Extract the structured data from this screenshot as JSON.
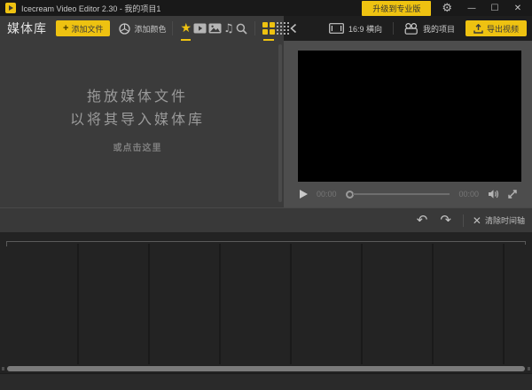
{
  "titlebar": {
    "app_title": "Icecream Video Editor 2.30 - 我的项目1",
    "upgrade_label": "升级到专业版",
    "minimize_glyph": "—",
    "maximize_glyph": "☐",
    "close_glyph": "✕",
    "gear_glyph": "⚙"
  },
  "media_library": {
    "title": "媒体库",
    "add_file_label": "添加文件",
    "add_file_plus": "+",
    "add_color_label": "添加颜色",
    "star_glyph": "★",
    "music_glyph": "♫",
    "dropzone_line1": "拖放媒体文件",
    "dropzone_line2": "以将其导入媒体库",
    "dropzone_line3": "或点击这里"
  },
  "project_bar": {
    "aspect_label": "16:9 横向",
    "projects_label": "我的项目",
    "export_label": "导出视频"
  },
  "preview": {
    "current_time": "00:00",
    "total_time": "00:00"
  },
  "timeline_bar": {
    "undo_glyph": "↶",
    "redo_glyph": "↷",
    "clear_x": "✕",
    "clear_label": "清除时间轴"
  },
  "timeline": {
    "columns": 7,
    "column_spacing_px": 80
  },
  "colors": {
    "accent_yellow": "#eec211",
    "panel_gray": "#3b3b3b",
    "preview_gray": "#4d4d4d",
    "timeline_dark": "#232323"
  }
}
